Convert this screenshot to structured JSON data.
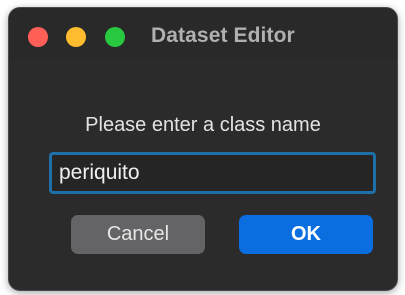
{
  "window": {
    "title": "Dataset Editor",
    "controls": [
      "close-button",
      "minimize-button",
      "maximize-button"
    ]
  },
  "dialog": {
    "prompt": "Please enter a class name",
    "input_value": "periquito",
    "cancel_label": "Cancel",
    "ok_label": "OK"
  },
  "colors": {
    "close": "#ff5f57",
    "minimize": "#febc2e",
    "maximize": "#28c840",
    "ok_button": "#0a6ee0",
    "cancel_button": "#646466",
    "input_focus_border": "#1f6fa8"
  }
}
